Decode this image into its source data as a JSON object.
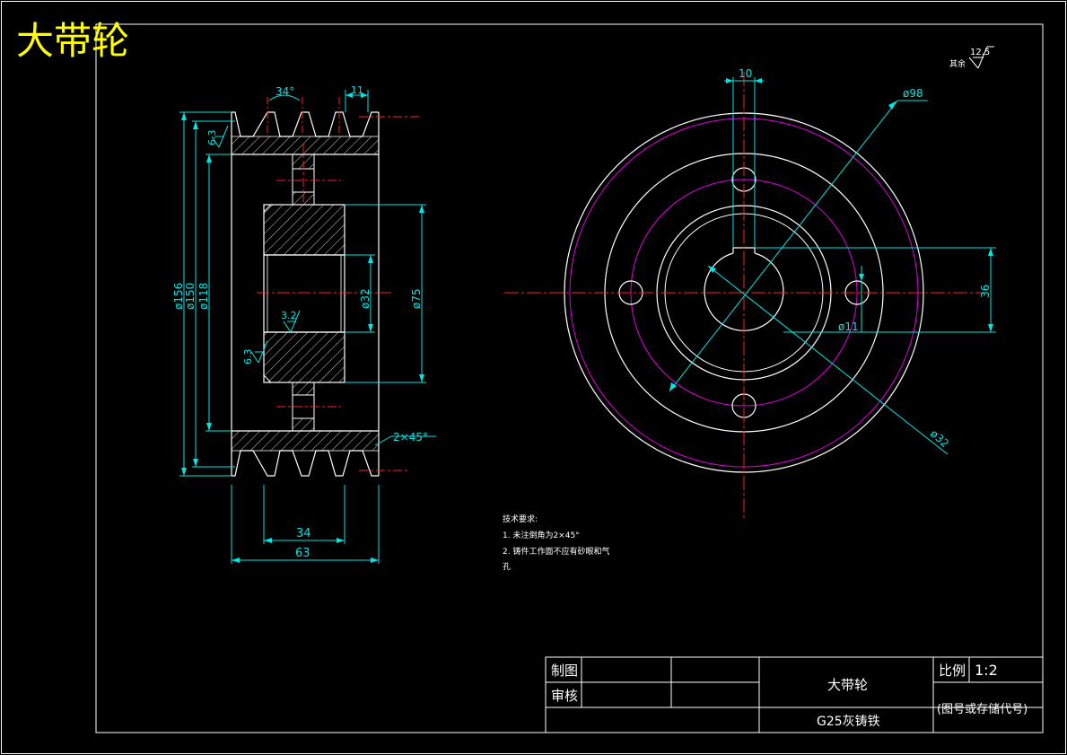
{
  "drawing": {
    "heading": "大带轮",
    "roughness_default": "12.5",
    "roughness_default_label": "其余"
  },
  "side_view": {
    "groove_angle": "34°",
    "groove_width": "11",
    "dia_outer": "ø156",
    "dia_150": "ø150",
    "dia_118": "ø118",
    "dia_bore": "ø32",
    "dia_hub": "ø75",
    "hub_length": "34",
    "total_width": "63",
    "chamfer": "2×45°",
    "roughness_top": "6.3",
    "roughness_bottom": "6.3",
    "roughness_bore": "3.2"
  },
  "front_view": {
    "key_width": "10",
    "pitch_circle": "ø98",
    "key_depth": "36",
    "hole_dia": "ø11",
    "bore_dia": "ø32"
  },
  "notes": {
    "title": "技术要求:",
    "line1": "1. 未注倒角为2×45°",
    "line2": "2. 铸件工作面不应有砂眼和气",
    "line3": "孔"
  },
  "title_block": {
    "drawn_label": "制图",
    "review_label": "审核",
    "part_name": "大带轮",
    "material": "G25灰铸铁",
    "scale_label": "比例",
    "scale_value": "1:2",
    "drawing_code": "(图号或存储代号)"
  },
  "colors": {
    "line": "#ffffff",
    "dimension": "#00e5e5",
    "centerline": "#ff2020",
    "pitch_circle": "#e000e0",
    "heading": "#ffff00"
  }
}
